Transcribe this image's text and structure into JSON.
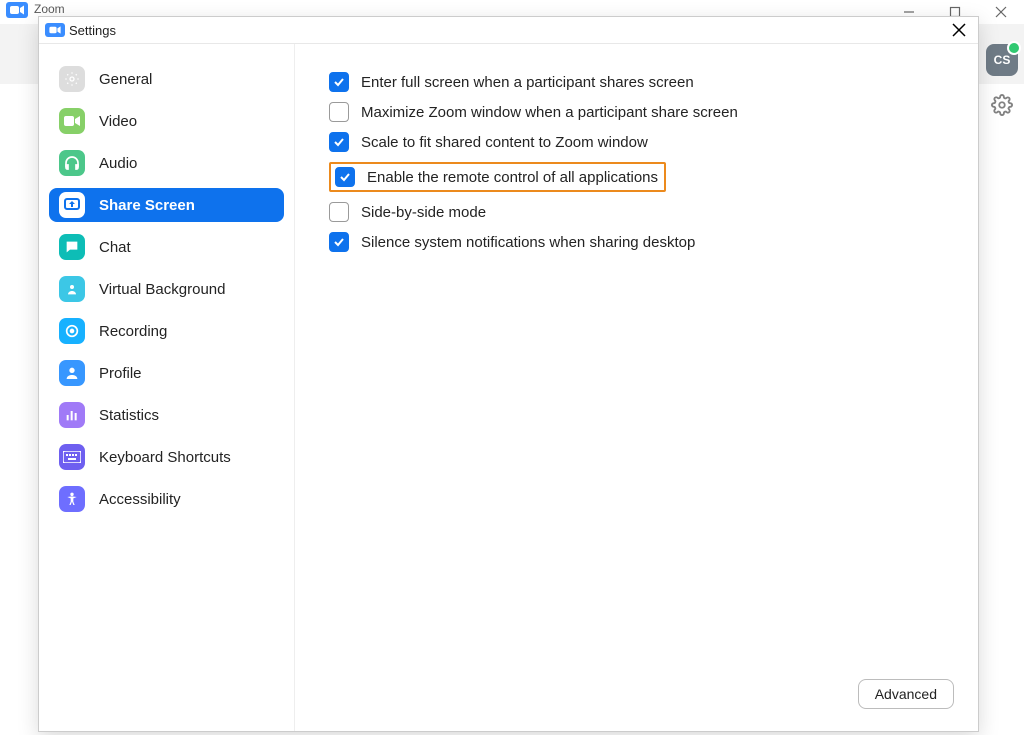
{
  "outer": {
    "title": "Zoom",
    "avatar_initials": "CS"
  },
  "dialog": {
    "title": "Settings"
  },
  "sidebar": {
    "items": [
      {
        "label": "General"
      },
      {
        "label": "Video"
      },
      {
        "label": "Audio"
      },
      {
        "label": "Share Screen"
      },
      {
        "label": "Chat"
      },
      {
        "label": "Virtual Background"
      },
      {
        "label": "Recording"
      },
      {
        "label": "Profile"
      },
      {
        "label": "Statistics"
      },
      {
        "label": "Keyboard Shortcuts"
      },
      {
        "label": "Accessibility"
      }
    ]
  },
  "options": [
    {
      "label": "Enter full screen when a participant shares screen",
      "checked": true
    },
    {
      "label": "Maximize Zoom window when a participant share screen",
      "checked": false
    },
    {
      "label": "Scale to fit shared content to Zoom window",
      "checked": true
    },
    {
      "label": "Enable the remote control of all applications",
      "checked": true,
      "highlighted": true
    },
    {
      "label": "Side-by-side mode",
      "checked": false
    },
    {
      "label": "Silence system notifications when sharing desktop",
      "checked": true
    }
  ],
  "buttons": {
    "advanced": "Advanced"
  }
}
